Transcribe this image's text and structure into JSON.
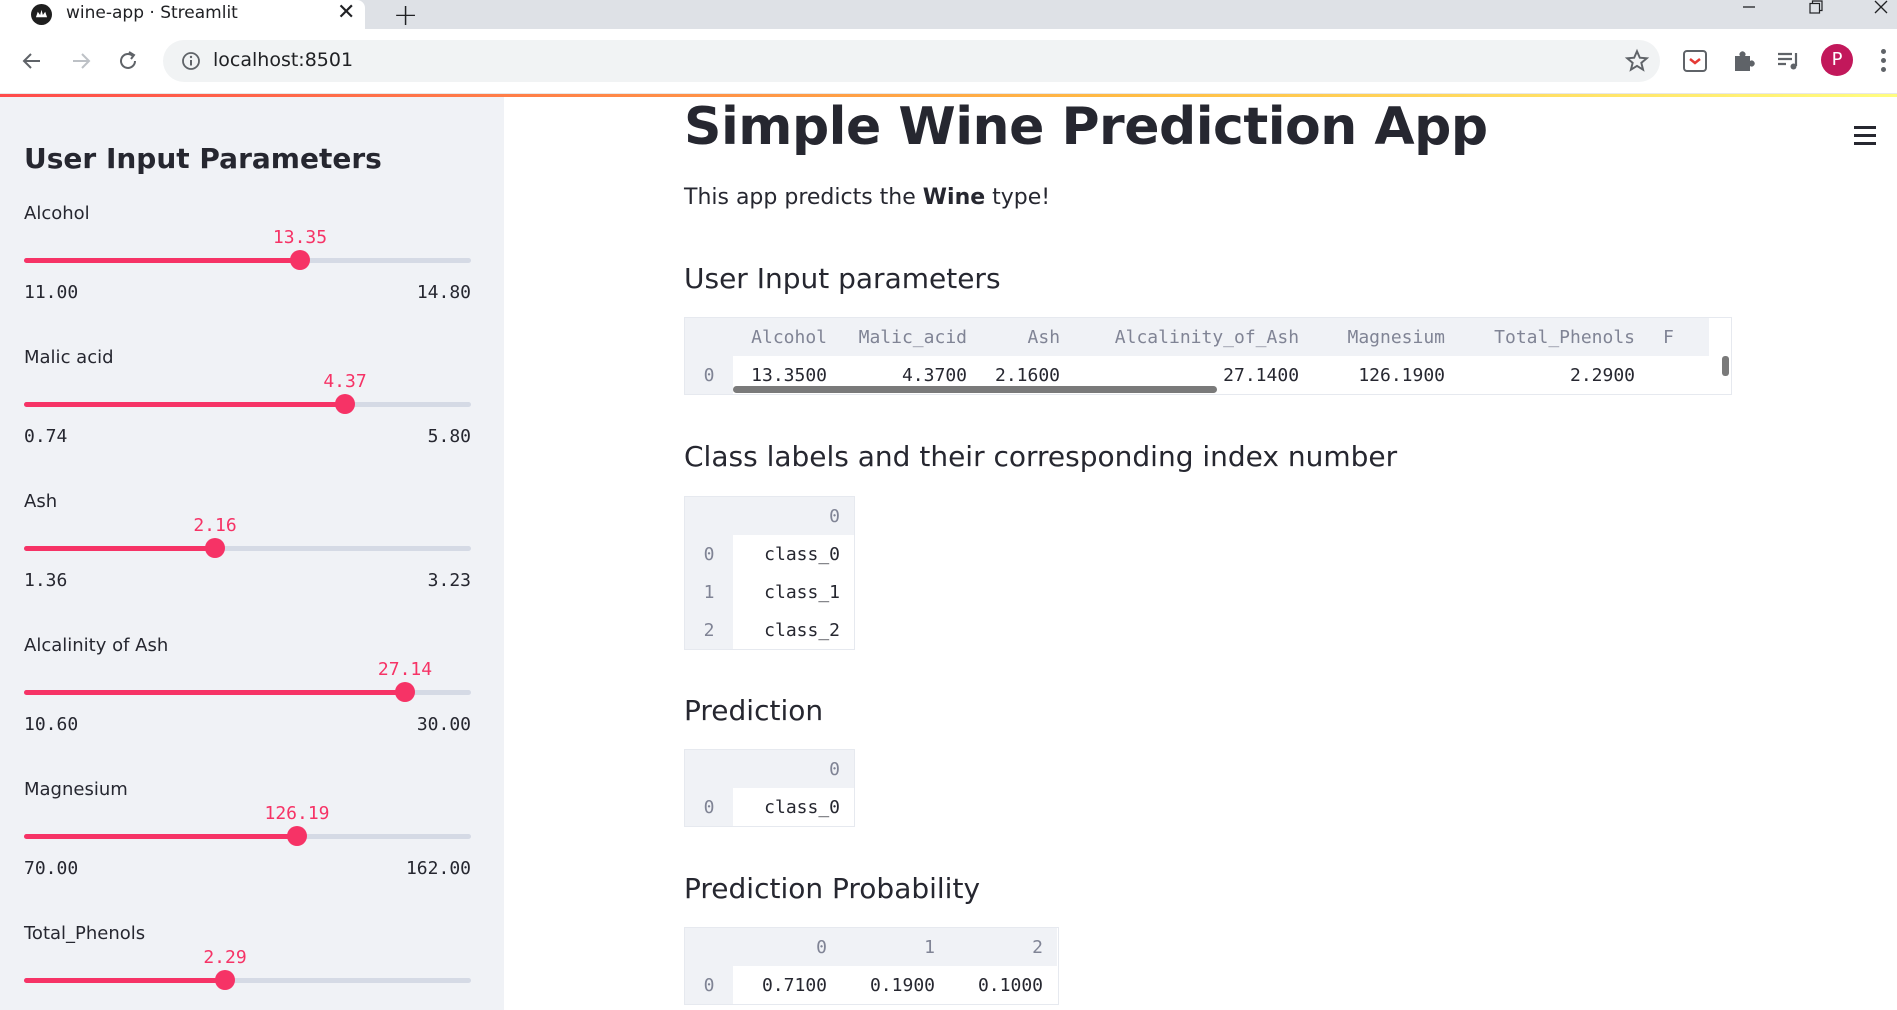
{
  "browser": {
    "tab_title": "wine-app · Streamlit",
    "url": "localhost:8501",
    "new_tab_symbol": "+",
    "close_symbol": "✕",
    "profile_initial": "P"
  },
  "sidebar": {
    "title": "User Input Parameters",
    "sliders": [
      {
        "label": "Alcohol",
        "value": "13.35",
        "min": "11.00",
        "max": "14.80",
        "fraction": 0.6184
      },
      {
        "label": "Malic acid",
        "value": "4.37",
        "min": "0.74",
        "max": "5.80",
        "fraction": 0.7174
      },
      {
        "label": "Ash",
        "value": "2.16",
        "min": "1.36",
        "max": "3.23",
        "fraction": 0.4278
      },
      {
        "label": "Alcalinity of Ash",
        "value": "27.14",
        "min": "10.60",
        "max": "30.00",
        "fraction": 0.8526
      },
      {
        "label": "Magnesium",
        "value": "126.19",
        "min": "70.00",
        "max": "162.00",
        "fraction": 0.6108
      },
      {
        "label": "Total_Phenols",
        "value": "2.29",
        "min": "",
        "max": "",
        "fraction": 0.45
      }
    ]
  },
  "main": {
    "title": "Simple Wine Prediction App",
    "intro_prefix": "This app predicts the ",
    "intro_bold": "Wine",
    "intro_suffix": " type!",
    "input_section": {
      "heading": "User Input parameters",
      "columns": [
        "Alcohol",
        "Malic_acid",
        "Ash",
        "Alcalinity_of_Ash",
        "Magnesium",
        "Total_Phenols",
        "F"
      ],
      "row_index": "0",
      "row": [
        "13.3500",
        "4.3700",
        "2.1600",
        "27.1400",
        "126.1900",
        "2.2900",
        ""
      ]
    },
    "class_section": {
      "heading": "Class labels and their corresponding index number",
      "column": "0",
      "rows": [
        {
          "index": "0",
          "value": "class_0"
        },
        {
          "index": "1",
          "value": "class_1"
        },
        {
          "index": "2",
          "value": "class_2"
        }
      ]
    },
    "prediction_section": {
      "heading": "Prediction",
      "column": "0",
      "rows": [
        {
          "index": "0",
          "value": "class_0"
        }
      ]
    },
    "probability_section": {
      "heading": "Prediction Probability",
      "columns": [
        "0",
        "1",
        "2"
      ],
      "row_index": "0",
      "row": [
        "0.7100",
        "0.1900",
        "0.1000"
      ]
    }
  },
  "colors": {
    "accent": "#f63366",
    "sidebar_bg": "#f0f2f6",
    "text": "#262730"
  }
}
